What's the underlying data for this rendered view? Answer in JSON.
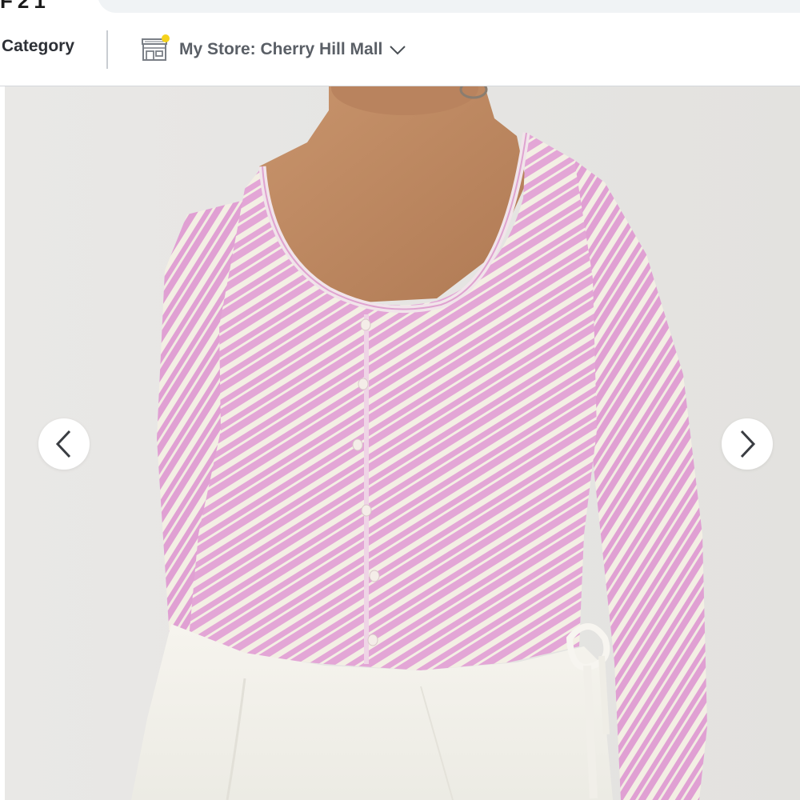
{
  "header": {
    "logo_fragment": "F21",
    "category_label": "Category",
    "store": {
      "label": "My Store: Cherry Hill Mall",
      "icon": "store-icon",
      "status_dot_color": "#f5d21b"
    }
  },
  "gallery": {
    "image_subject": "striped-top-photo",
    "prev_icon": "chevron-left-icon",
    "next_icon": "chevron-right-icon",
    "colors": {
      "stripe_pink": "#e3a6d6",
      "stripe_cream": "#f3efe4",
      "skirt": "#f4f2ec",
      "skin": "#c18a62"
    }
  }
}
